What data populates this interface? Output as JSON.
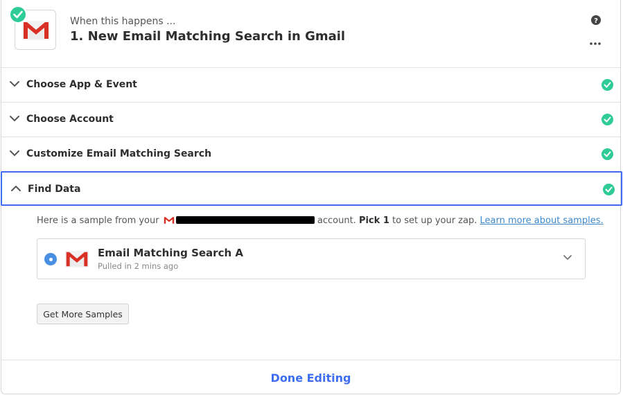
{
  "header": {
    "when_label": "When this happens ...",
    "step_title": "1. New Email Matching Search in Gmail",
    "app_icon": "gmail-icon",
    "status": "complete"
  },
  "sections": [
    {
      "label": "Choose App & Event",
      "status": "complete",
      "expanded": false
    },
    {
      "label": "Choose Account",
      "status": "complete",
      "expanded": false
    },
    {
      "label": "Customize Email Matching Search",
      "status": "complete",
      "expanded": false
    },
    {
      "label": "Find Data",
      "status": "complete",
      "expanded": true
    }
  ],
  "find_data": {
    "intro_prefix": "Here is a sample from your",
    "intro_middle": "account.",
    "pick_bold": "Pick 1",
    "intro_suffix": "to set up your zap.",
    "learn_link": "Learn more about samples.",
    "sample": {
      "name": "Email Matching Search A",
      "pulled": "Pulled in 2 mins ago",
      "selected": true
    },
    "more_samples_label": "Get More Samples"
  },
  "footer": {
    "done_label": "Done Editing"
  },
  "colors": {
    "accent": "#3d6df0",
    "success": "#2fcc99",
    "link": "#3d87c9",
    "radio": "#4a90e2"
  }
}
